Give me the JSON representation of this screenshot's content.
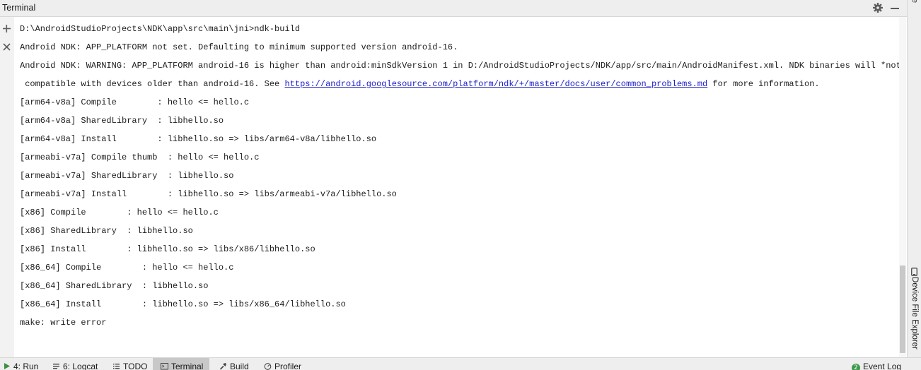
{
  "window": {
    "title": "Terminal"
  },
  "right_strip": {
    "top_tab_label": "e",
    "device_file_explorer_label": "Device File Explorer"
  },
  "terminal": {
    "lines": [
      "D:\\AndroidStudioProjects\\NDK\\app\\src\\main\\jni>ndk-build",
      "Android NDK: APP_PLATFORM not set. Defaulting to minimum supported version android-16.",
      "Android NDK: WARNING: APP_PLATFORM android-16 is higher than android:minSdkVersion 1 in D:/AndroidStudioProjects/NDK/app/src/main/AndroidManifest.xml. NDK binaries will *not* be",
      " compatible with devices older than android-16. See ",
      "[arm64-v8a] Compile        : hello <= hello.c",
      "[arm64-v8a] SharedLibrary  : libhello.so",
      "[arm64-v8a] Install        : libhello.so => libs/arm64-v8a/libhello.so",
      "[armeabi-v7a] Compile thumb  : hello <= hello.c",
      "[armeabi-v7a] SharedLibrary  : libhello.so",
      "[armeabi-v7a] Install        : libhello.so => libs/armeabi-v7a/libhello.so",
      "[x86] Compile        : hello <= hello.c",
      "[x86] SharedLibrary  : libhello.so",
      "[x86] Install        : libhello.so => libs/x86/libhello.so",
      "[x86_64] Compile        : hello <= hello.c",
      "[x86_64] SharedLibrary  : libhello.so",
      "[x86_64] Install        : libhello.so => libs/x86_64/libhello.so",
      "make: write error"
    ],
    "link": {
      "text": "https://android.googlesource.com/platform/ndk/+/master/docs/user/common_problems.md",
      "suffix": " for more information."
    }
  },
  "bottom_tabs": [
    {
      "label": "4: Run",
      "icon": "run-icon"
    },
    {
      "label": "6: Logcat",
      "icon": "logcat-icon"
    },
    {
      "label": "TODO",
      "icon": "todo-icon"
    },
    {
      "label": "Terminal",
      "icon": "terminal-icon",
      "active": true
    },
    {
      "label": "Build",
      "icon": "build-hammer-icon"
    },
    {
      "label": "Profiler",
      "icon": "profiler-icon"
    }
  ],
  "event_log": {
    "label": "Event Log",
    "badge_count": "2",
    "badge_color": "#3d9a4a"
  },
  "colors": {
    "link": "#1e22c8",
    "active_tab": "#c8c8c8",
    "panel_bg": "#eeeeee",
    "terminal_bg": "#ffffff"
  }
}
